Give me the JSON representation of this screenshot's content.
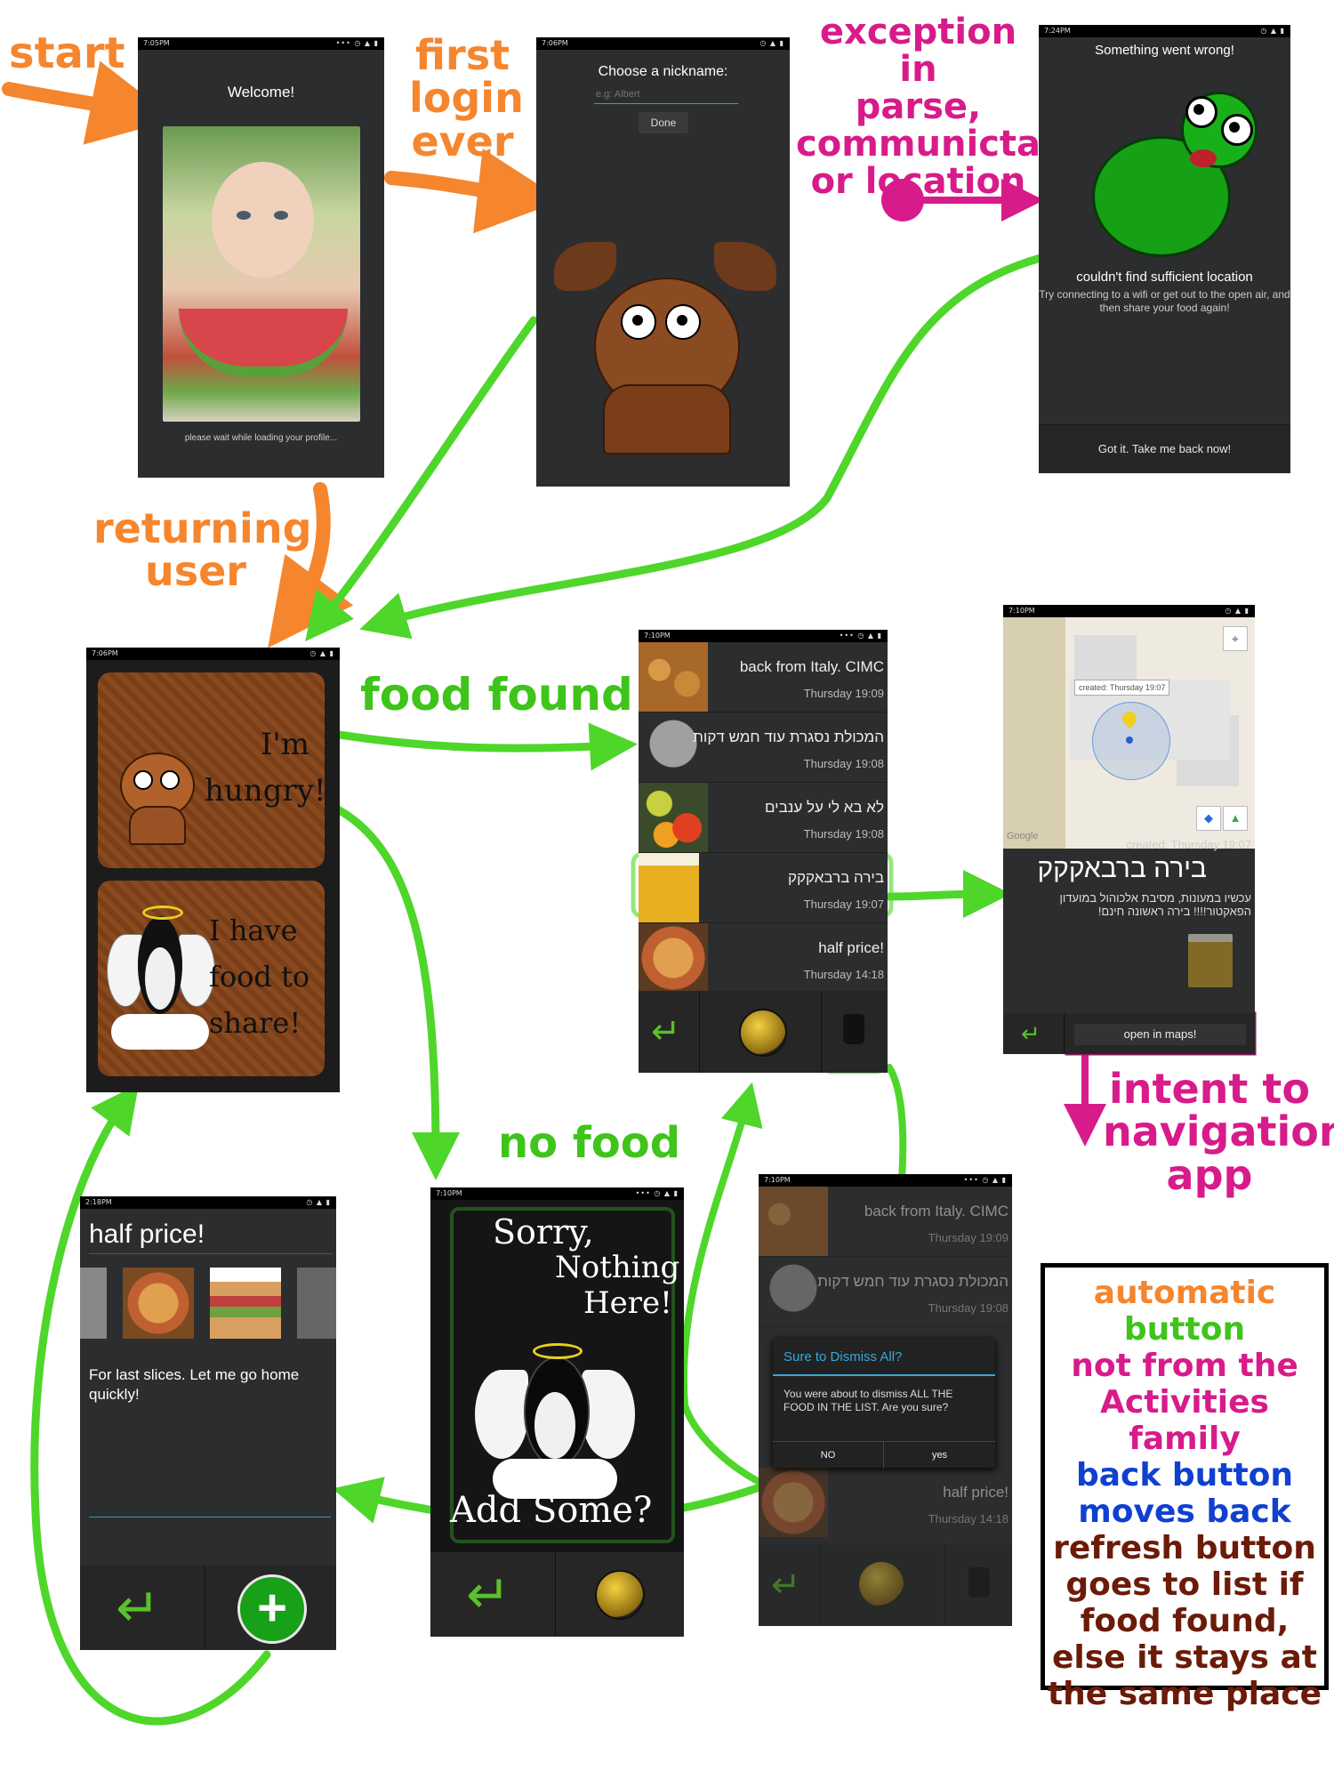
{
  "labels": {
    "start": "start",
    "first_login": [
      "first",
      "login",
      "ever"
    ],
    "exception": [
      "exception in",
      "parse,",
      "communictaion",
      "or location"
    ],
    "returning_user": [
      "returning",
      "user"
    ],
    "food_found": "food found",
    "no_food": "no food",
    "intent": [
      "intent to",
      "navigation",
      "app"
    ]
  },
  "legend": {
    "automatic": "automatic",
    "button": "button",
    "not_activities": [
      "not from the",
      "Activities family"
    ],
    "back": [
      "back button",
      "moves back"
    ],
    "refresh": [
      "refresh button",
      "goes to list if",
      "food found,",
      "else it stays at",
      "the same place"
    ]
  },
  "screens": {
    "welcome": {
      "time": "7:05PM",
      "title": "Welcome!",
      "footer": "please wait while loading your profile..."
    },
    "nickname": {
      "time": "7:06PM",
      "prompt": "Choose a nickname:",
      "placeholder": "e.g: Albert",
      "done": "Done"
    },
    "error": {
      "time": "7:24PM",
      "title": "Something went wrong!",
      "headline": "couldn't find sufficient location",
      "message": "Try connecting to a wifi or get out to the open air, and then share your food again!",
      "button": "Got it. Take me back now!"
    },
    "home": {
      "time": "7:06PM",
      "hungry": [
        "I'm",
        "hungry!"
      ],
      "share": [
        "I have",
        "food to",
        "share!"
      ]
    },
    "list": {
      "time": "7:10PM",
      "items": [
        {
          "title": "back from Italy. CIMC",
          "time": "Thursday 19:09"
        },
        {
          "title": "המכולת נסגרת עוד חמש דקות",
          "time": "Thursday 19:08"
        },
        {
          "title": "לא בא לי על ענבים",
          "time": "Thursday 19:08"
        },
        {
          "title": "בירה ברבאקקק",
          "time": "Thursday 19:07"
        },
        {
          "title": "half price!",
          "time": "Thursday 14:18"
        }
      ]
    },
    "map": {
      "time": "7:10PM",
      "marker_label": "created: Thursday 19:07",
      "google": "Google",
      "created": "created: Thursday 19:07",
      "title": "בירה ברבאקקק",
      "description": "עכשיו במעונות, מסיבת אלכוהול במועדון הפאקטור!!!! בירה ראשונה חינם!",
      "open_maps": "open in maps!"
    },
    "share": {
      "time": "2:18PM",
      "title": "half price!",
      "description": "For last slices. Let me go home quickly!"
    },
    "nothing": {
      "time": "7:10PM",
      "sorry": "Sorry,",
      "nothing": "Nothing",
      "here": "Here!",
      "add": "Add Some?"
    },
    "dismiss": {
      "time": "7:10PM",
      "items": [
        {
          "title": "back from Italy. CIMC",
          "time": "Thursday 19:09"
        },
        {
          "title": "המכולת נסגרת עוד חמש דקות",
          "time": "Thursday 19:08"
        }
      ],
      "partial_title": "half price!",
      "partial_time": "Thursday 14:18",
      "dialog_title": "Sure to Dismiss All?",
      "dialog_text": "You were about to dismiss ALL THE FOOD IN THE LIST. Are you sure?",
      "no": "NO",
      "yes": "yes"
    }
  },
  "colors": {
    "start_arrow": "#f5862e",
    "flow_arrow": "#4fd62a",
    "exception_arrow": "#d81b8a"
  }
}
